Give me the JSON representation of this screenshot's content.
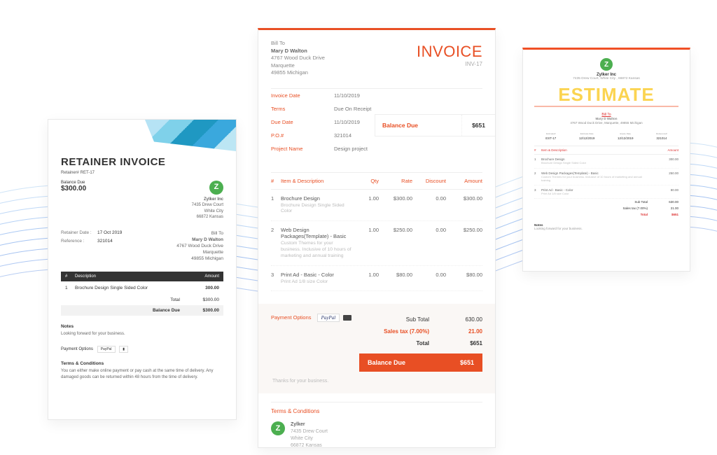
{
  "retainer": {
    "title": "RETAINER INVOICE",
    "ref": "Retainer# RET-17",
    "balance_label": "Balance Due",
    "balance_amount": "$300.00",
    "company": {
      "name": "Zylker Inc",
      "addr1": "7435 Drew Court",
      "addr2": "White City",
      "addr3": "66872 Kansas"
    },
    "meta": {
      "date_k": "Retainer Date :",
      "date_v": "17 Oct 2019",
      "ref_k": "Reference :",
      "ref_v": "321014",
      "billto_h": "Bill To",
      "billto_name": "Mary D Walton",
      "billto_1": "4767 Wood Duck Drive",
      "billto_2": "Marquette",
      "billto_3": "49855 Michigan"
    },
    "thead": {
      "n": "#",
      "d": "Description",
      "a": "Amount"
    },
    "items": [
      {
        "n": "1",
        "d": "Brochure Design Single Sided Color",
        "a": "300.00"
      }
    ],
    "totals": {
      "total_l": "Total",
      "total_v": "$300.00",
      "bal_l": "Balance Due",
      "bal_v": "$300.00"
    },
    "notes": {
      "h": "Notes",
      "p": "Looking forward for your business."
    },
    "payopt": {
      "h": "Payment Options",
      "pp": "PayPal"
    },
    "terms": {
      "h": "Terms & Conditions",
      "p": "You can either make online payment or pay cash at the same time of delivery. Any damaged goods can be returned within 48 hours from the time of delivery."
    }
  },
  "invoice": {
    "title": "INVOICE",
    "number": "INV-17",
    "bill": {
      "h": "Bill To",
      "name": "Mary D Walton",
      "l1": "4767 Wood Duck Drive",
      "l2": "Marquette",
      "l3": "49855 Michigan"
    },
    "meta": [
      {
        "k": "Invoice Date",
        "v": "11/10/2019"
      },
      {
        "k": "Terms",
        "v": "Due On Receipt"
      },
      {
        "k": "Due Date",
        "v": "11/10/2019"
      },
      {
        "k": "P.O.#",
        "v": "321014"
      },
      {
        "k": "Project Name",
        "v": "Design project"
      }
    ],
    "balbox": {
      "k": "Balance Due",
      "v": "$651"
    },
    "thead": {
      "n": "#",
      "d": "Item & Description",
      "q": "Qty",
      "r": "Rate",
      "ds": "Discount",
      "a": "Amount"
    },
    "items": [
      {
        "n": "1",
        "t": "Brochure Design",
        "s": "Brochure Design Single Sided Color",
        "q": "1.00",
        "r": "$300.00",
        "ds": "0.00",
        "a": "$300.00"
      },
      {
        "n": "2",
        "t": "Web Design Packages(Template) - Basic",
        "s": "Custom Themes for your business. Inclusive of 10 hours of marketing and annual training",
        "q": "1.00",
        "r": "$250.00",
        "ds": "0.00",
        "a": "$250.00"
      },
      {
        "n": "3",
        "t": "Print Ad - Basic - Color",
        "s": "Print Ad 1/8 size Color",
        "q": "1.00",
        "r": "$80.00",
        "ds": "0.00",
        "a": "$80.00"
      }
    ],
    "pay": {
      "h": "Payment Options",
      "pp": "PayPal"
    },
    "summary": {
      "sub_l": "Sub Total",
      "sub_v": "630.00",
      "tax_l": "Sales tax (7.00%)",
      "tax_v": "21.00",
      "tot_l": "Total",
      "tot_v": "$651",
      "bal_l": "Balance Due",
      "bal_v": "$651"
    },
    "thanks": "Thanks for your business.",
    "terms_h": "Terms & Conditions",
    "org": {
      "name": "Zylker",
      "l1": "7435 Drew Court",
      "l2": "White City",
      "l3": "66872 Kansas"
    }
  },
  "estimate": {
    "org": {
      "name": "Zylker Inc",
      "addr": "7435 Drew Court, White City , 66872 Kansas"
    },
    "title": "ESTIMATE",
    "bill": {
      "h": "Bill To",
      "name": "Mary D Walton",
      "addr": "4767 Wood Duck Drive, Marquette, 49855 Michigan"
    },
    "meta": [
      {
        "k": "Estimate#",
        "v": "EST-17"
      },
      {
        "k": "Estimate Date",
        "v": "12/12/2019"
      },
      {
        "k": "Expiry Date",
        "v": "12/12/2019"
      },
      {
        "k": "Reference#",
        "v": "321014"
      }
    ],
    "thead": {
      "n": "#",
      "d": "Item & Description",
      "a": "Amount"
    },
    "items": [
      {
        "n": "1",
        "t": "Brochure Design",
        "s": "Brochure Design Single Sided Color",
        "a": "300.00"
      },
      {
        "n": "2",
        "t": "Web Design Packages(Template) - Basic",
        "s": "Custom Themes for your business. Inclusive of 10 hours of marketing and annual training",
        "a": "250.00"
      },
      {
        "n": "3",
        "t": "Print Ad - Basic - Color",
        "s": "Print Ad 1/8 size Color",
        "a": "80.00"
      }
    ],
    "totals": {
      "sub_l": "Sub Total",
      "sub_v": "630.00",
      "tax_l": "Sales tax (7.00%)",
      "tax_v": "21.00",
      "tot_l": "Total",
      "tot_v": "$651"
    },
    "notes": {
      "h": "Notes",
      "p": "Looking forward for your business."
    }
  },
  "logo_letter": "Z"
}
